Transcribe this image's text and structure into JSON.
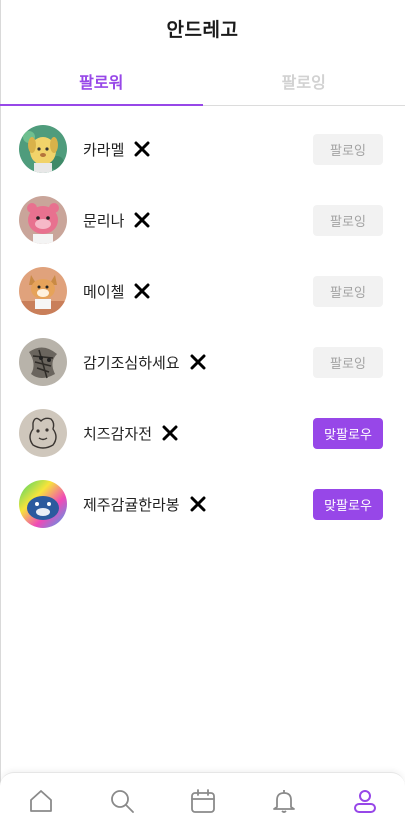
{
  "header": {
    "title": "안드레고"
  },
  "tabs": [
    {
      "label": "팔로워",
      "active": true
    },
    {
      "label": "팔로잉",
      "active": false
    }
  ],
  "followers": [
    {
      "name": "카라멜",
      "button": "팔로잉",
      "state": "following",
      "avatar": "dog-yellow"
    },
    {
      "name": "문리나",
      "button": "팔로잉",
      "state": "following",
      "avatar": "pink-animal"
    },
    {
      "name": "메이첼",
      "button": "팔로잉",
      "state": "following",
      "avatar": "corgi"
    },
    {
      "name": "감기조심하세요",
      "button": "팔로잉",
      "state": "following",
      "avatar": "sketch-cat"
    },
    {
      "name": "치즈감자전",
      "button": "맞팔로우",
      "state": "followback",
      "avatar": "drawn-bear"
    },
    {
      "name": "제주감귤한라봉",
      "button": "맞팔로우",
      "state": "followback",
      "avatar": "blue-creature"
    }
  ],
  "nav": [
    {
      "icon": "home-icon",
      "active": false
    },
    {
      "icon": "search-icon",
      "active": false
    },
    {
      "icon": "calendar-icon",
      "active": false
    },
    {
      "icon": "bell-icon",
      "active": false
    },
    {
      "icon": "profile-icon",
      "active": true
    }
  ],
  "colors": {
    "accent": "#9747e8",
    "inactive": "#d2d2d2",
    "following_bg": "#f2f2f2",
    "icon": "#8a8a8a"
  }
}
